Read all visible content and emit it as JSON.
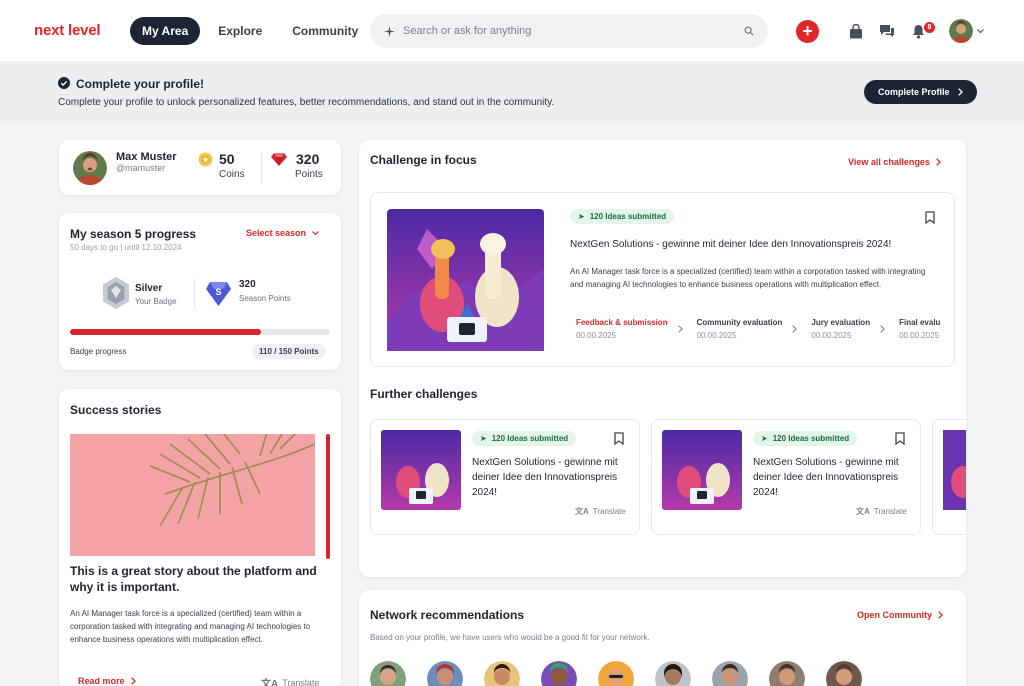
{
  "app": {
    "logo": "next level"
  },
  "nav": {
    "items": [
      "My Area",
      "Explore",
      "Community"
    ],
    "active": "My Area"
  },
  "search": {
    "placeholder": "Search or ask for anything"
  },
  "notifications": {
    "count": "8"
  },
  "banner": {
    "title": "Complete your profile!",
    "text": "Complete your profile to unlock personalized features, better recommendations, and stand out in the community.",
    "button": "Complete Profile"
  },
  "profile": {
    "name": "Max Muster",
    "handle": "@mamuster",
    "coins_value": "50",
    "coins_label": "Coins",
    "points_value": "320",
    "points_label": "Points"
  },
  "season": {
    "title": "My season 5 progress",
    "subtitle": "50 days to go | until 12.10.2024",
    "select": "Select season",
    "badge_name": "Silver",
    "badge_label": "Your Badge",
    "season_points": "320",
    "season_points_label": "Season Points",
    "season_badge_letter": "S",
    "progress_label": "Badge progress",
    "progress_text": "110 / 150 Points",
    "progress_fraction": 0.733
  },
  "stories": {
    "title": "Success stories",
    "story_title": "This is a great story about the platform and why it is important.",
    "story_text": "An AI Manager task force is a specialized (certified) team within a corporation tasked with integrating and managing AI technologies to enhance business operations with multiplication effect.",
    "read_more": "Read more",
    "translate": "Translate"
  },
  "focus": {
    "title": "Challenge in focus",
    "view_all": "View all challenges",
    "tag": "120 Ideas submitted",
    "challenge_title": "NextGen Solutions - gewinne mit deiner Idee den Innovationspreis 2024!",
    "challenge_text": "An AI Manager task force is a specialized (certified) team within a corporation tasked with integrating and managing AI technologies to enhance business operations with multiplication effect.",
    "steps": [
      {
        "label": "Feedback & submission",
        "date": "00.00.2025"
      },
      {
        "label": "Community evaluation",
        "date": "00.00.2025"
      },
      {
        "label": "Jury evaluation",
        "date": "00.00.2025"
      },
      {
        "label": "Final evalu",
        "date": "00.00.2025"
      }
    ]
  },
  "further": {
    "title": "Further challenges",
    "cards": [
      {
        "tag": "120 Ideas submitted",
        "title": "NextGen Solutions - gewinne mit deiner Idee den Innovationspreis 2024!",
        "translate": "Translate"
      },
      {
        "tag": "120 Ideas submitted",
        "title": "NextGen Solutions - gewinne mit deiner Idee den Innovationspreis 2024!",
        "translate": "Translate"
      }
    ]
  },
  "network": {
    "title": "Network recommendations",
    "link": "Open Community",
    "subtitle": "Based on your profile, we have users who would be a good fit for your network."
  },
  "colors": {
    "accent": "#e0262b",
    "dark": "#1d2433",
    "green_tag": "#e3f5ea"
  }
}
